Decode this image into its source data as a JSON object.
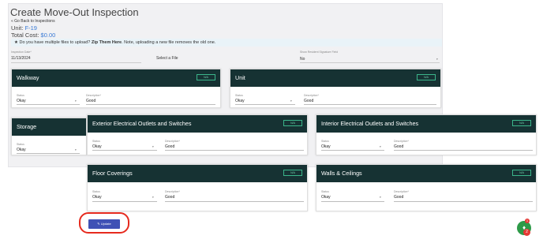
{
  "page": {
    "title": "Create Move-Out Inspection",
    "back_icon": "double-chevron-left",
    "back_link": "Go Back to Inspections",
    "unit_label": "Unit:",
    "unit_value": "F-19",
    "cost_label": "Total Cost:",
    "cost_value": "$0.00"
  },
  "zip_banner": {
    "icon": "star",
    "text": "Do you have multiple files to upload?",
    "link": "Zip Them Here",
    "note": ". Note, uploading a new file removes the old one."
  },
  "form": {
    "date_label": "Inspection Date*",
    "date_value": "11/13/2024",
    "file_label": "Select a File",
    "signature_label": "Show Resident Signature Field",
    "signature_value": "No",
    "signature_caret": "▾"
  },
  "field_labels": {
    "status": "Status",
    "description": "Description*",
    "na_button": "N/A",
    "caret": "▾"
  },
  "cards": {
    "walkway": {
      "title": "Walkway",
      "status": "Okay",
      "description": "Good"
    },
    "unit": {
      "title": "Unit",
      "status": "Okay",
      "description": "Good"
    },
    "storage": {
      "title": "Storage",
      "status": "Okay"
    },
    "exterior": {
      "title": "Exterior Electrical Outlets and Switches",
      "status": "Okay",
      "description": "Good"
    },
    "interior": {
      "title": "Interior Electrical Outlets and Switches",
      "status": "Okay",
      "description": "Good"
    },
    "floor": {
      "title": "Floor Coverings",
      "status": "Okay",
      "description": "Good"
    },
    "walls": {
      "title": "Walls & Ceilings",
      "status": "Okay",
      "description": "Good"
    }
  },
  "update_button": {
    "icon": "edit",
    "label": "Update"
  },
  "fab": {
    "icon": "bell",
    "badge_top": "1",
    "badge_bottom": "2"
  },
  "colors": {
    "card_header": "#163233",
    "na_border": "#3bb58a",
    "update_button": "#3f51b5",
    "highlight_ring": "#e62a1e",
    "link": "#3a7bd5",
    "fab": "#2e9a48"
  }
}
